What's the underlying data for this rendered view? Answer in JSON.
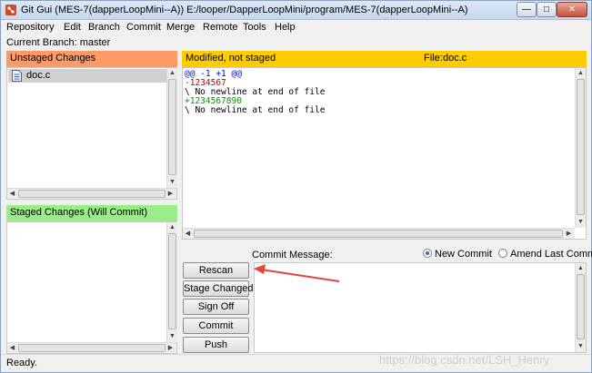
{
  "window": {
    "title": "Git Gui (MES-7(dapperLoopMini--A)) E:/looper/DapperLoopMini/program/MES-7(dapperLoopMini--A)",
    "close_glyph": "✕",
    "min_glyph": "—",
    "max_glyph": "□"
  },
  "menu": [
    "Repository",
    "Edit",
    "Branch",
    "Commit",
    "Merge",
    "Remote",
    "Tools",
    "Help"
  ],
  "branch_line": "Current Branch: master",
  "unstaged": {
    "header": "Unstaged Changes",
    "files": [
      {
        "name": "doc.c",
        "icon": "modified-file-icon"
      }
    ]
  },
  "staged": {
    "header": "Staged Changes (Will Commit)",
    "files": []
  },
  "diff": {
    "status": "Modified, not staged",
    "file_label": "File:",
    "file_name": "doc.c",
    "lines": [
      {
        "kind": "hunk",
        "text": "@@ -1 +1 @@"
      },
      {
        "kind": "del",
        "text": "-1234567"
      },
      {
        "kind": "meta",
        "text": "\\ No newline at end of file"
      },
      {
        "kind": "add",
        "text": "+1234567890"
      },
      {
        "kind": "meta",
        "text": "\\ No newline at end of file"
      }
    ]
  },
  "commit": {
    "label": "Commit Message:",
    "new_commit": "New Commit",
    "amend": "Amend Last Commit",
    "selected": "new"
  },
  "buttons": {
    "rescan": "Rescan",
    "stage": "Stage Changed",
    "signoff": "Sign Off",
    "commit": "Commit",
    "push": "Push"
  },
  "status": "Ready.",
  "watermark": "https://blog.csdn.net/LSH_Henry",
  "colors": {
    "unstaged_header": "#ff9966",
    "staged_header": "#99ee88",
    "diff_header": "#ffcc00",
    "annotation_arrow": "#e8443a"
  }
}
